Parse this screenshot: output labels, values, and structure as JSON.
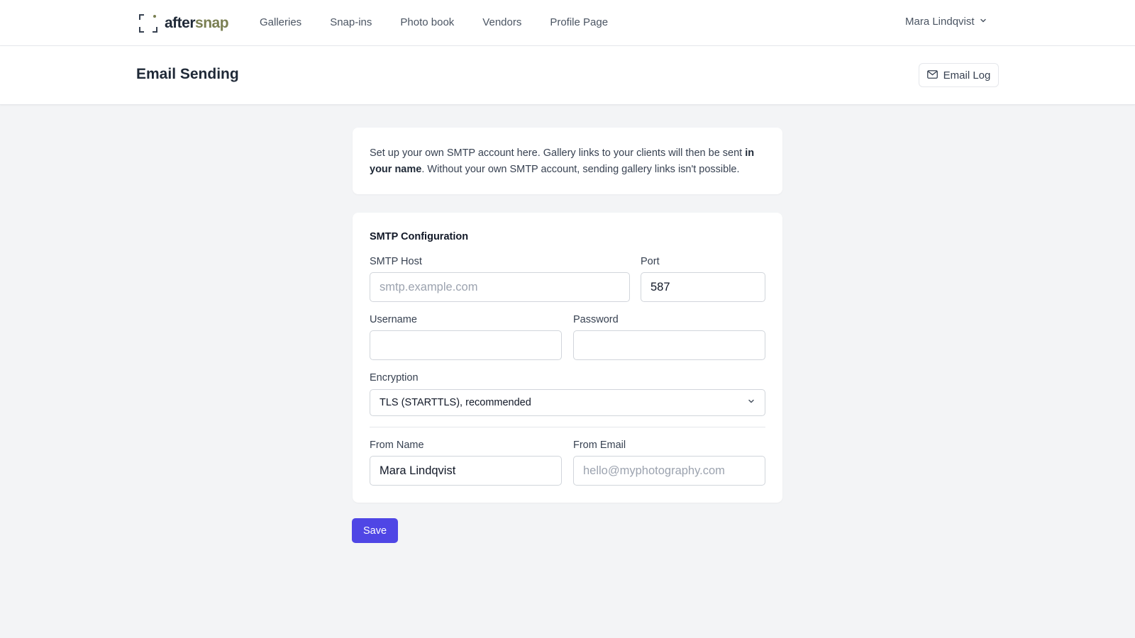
{
  "brand": {
    "name_part1": "after",
    "name_part2": "snap",
    "accent_color": "#7a7f52"
  },
  "nav": {
    "items": [
      {
        "label": "Galleries"
      },
      {
        "label": "Snap-ins"
      },
      {
        "label": "Photo book"
      },
      {
        "label": "Vendors"
      },
      {
        "label": "Profile Page"
      }
    ]
  },
  "user": {
    "name": "Mara Lindqvist",
    "icon": "chevron-down-icon"
  },
  "header": {
    "title": "Email Sending",
    "email_log_label": "Email Log",
    "email_log_icon": "mail-icon"
  },
  "info": {
    "text_before": "Set up your own SMTP account here. Gallery links to your clients will then be sent ",
    "text_bold": "in your name",
    "text_after": ". Without your own SMTP account, sending gallery links isn't possible."
  },
  "smtp": {
    "section_title": "SMTP Configuration",
    "host_label": "SMTP Host",
    "host_placeholder": "smtp.example.com",
    "host_value": "",
    "port_label": "Port",
    "port_value": "587",
    "username_label": "Username",
    "username_value": "",
    "password_label": "Password",
    "password_value": "",
    "encryption_label": "Encryption",
    "encryption_selected": "TLS (STARTTLS), recommended",
    "from_name_label": "From Name",
    "from_name_value": "Mara Lindqvist",
    "from_email_label": "From Email",
    "from_email_placeholder": "hello@myphotography.com",
    "from_email_value": ""
  },
  "actions": {
    "save_label": "Save",
    "save_color": "#4f46e5"
  }
}
